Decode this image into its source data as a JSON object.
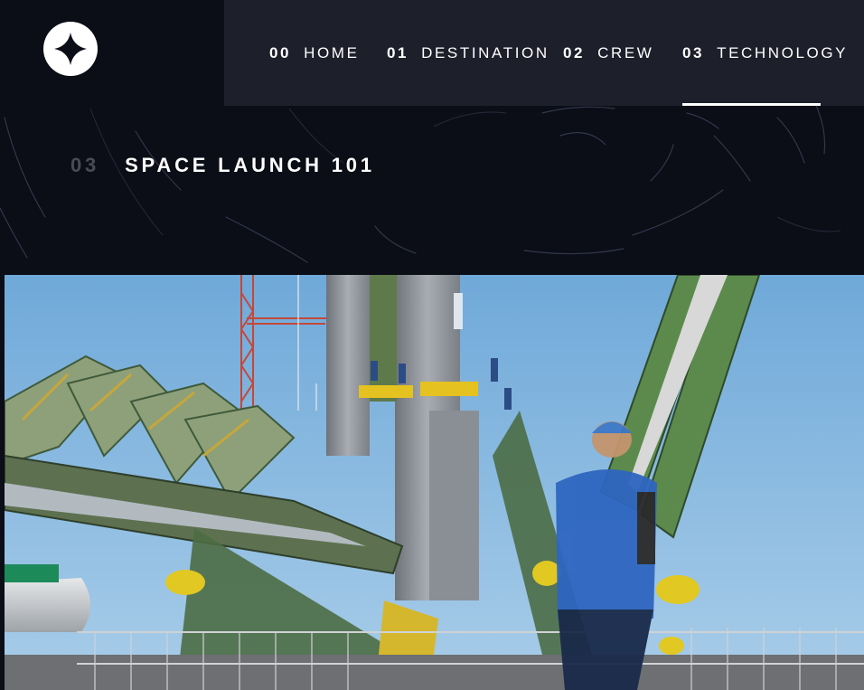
{
  "nav": {
    "items": [
      {
        "number": "00",
        "label": "HOME"
      },
      {
        "number": "01",
        "label": "DESTINATION"
      },
      {
        "number": "02",
        "label": "CREW"
      },
      {
        "number": "03",
        "label": "TECHNOLOGY"
      }
    ],
    "active": "TECHNOLOGY"
  },
  "heading": {
    "number": "03",
    "title": "SPACE LAUNCH 101"
  },
  "colors": {
    "background": "#0b0d17",
    "navbar": "#1d1f2a",
    "text": "#ffffff",
    "muted_number": "#4a4c55",
    "sky": "#7db4de"
  },
  "icons": {
    "logo": "four-point-star-logo-icon"
  },
  "hero_image": "rocket-launch-pad-photo"
}
